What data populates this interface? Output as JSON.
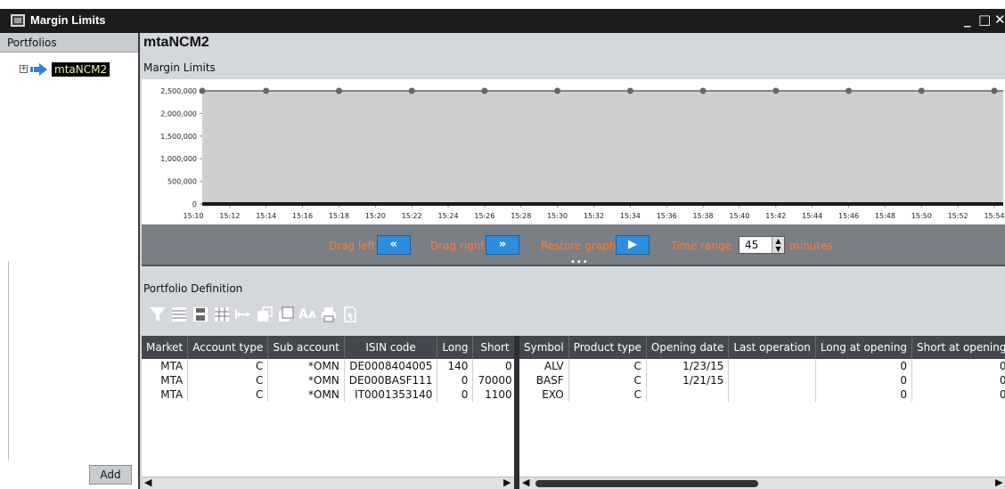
{
  "window": {
    "title": "Margin Limits",
    "controls": [
      "_",
      "□",
      "✕"
    ]
  },
  "left_panel": {
    "header": "Portfolios",
    "tree_item": "mtaNCM2",
    "add_button": "Add"
  },
  "main": {
    "portfolio_title": "mtaNCM2",
    "section_title": "Margin Limits",
    "definition_title": "Portfolio Definition"
  },
  "chart_data": {
    "type": "line",
    "title": "",
    "xlabel": "",
    "ylabel": "",
    "y_ticks": [
      "2,500,000",
      "2,000,000",
      "1,500,000",
      "1,000,000",
      "500,000",
      "0"
    ],
    "x_ticks": [
      "15:10",
      "15:12",
      "15:14",
      "15:16",
      "15:18",
      "15:20",
      "15:22",
      "15:24",
      "15:26",
      "15:28",
      "15:30",
      "15:32",
      "15:34",
      "15:36",
      "15:38",
      "15:40",
      "15:42",
      "15:44",
      "15:46",
      "15:48",
      "15:50",
      "15:52",
      "15:54"
    ],
    "ylim": [
      0,
      2500000
    ],
    "grid": false,
    "series": [
      {
        "x": [
          "15:10",
          "15:14",
          "15:18",
          "15:22",
          "15:26",
          "15:30",
          "15:34",
          "15:38",
          "15:42",
          "15:46",
          "15:50",
          "15:54"
        ],
        "values": [
          2500000,
          2500000,
          2500000,
          2500000,
          2500000,
          2500000,
          2500000,
          2500000,
          2500000,
          2500000,
          2500000,
          2500000
        ],
        "color": "#666666"
      },
      {
        "x": [
          "15:10",
          "15:54"
        ],
        "values": [
          0,
          0
        ],
        "color": "#1a1a1a"
      }
    ]
  },
  "controls": {
    "drag_left": "Drag left",
    "drag_right": "Drag right",
    "restore_graph": "Restore graph",
    "time_range": "Time range",
    "time_value": "45",
    "minutes": "minutes",
    "label_color": "#ff7d2a"
  },
  "toolbar_icons": [
    "filter-icon",
    "list-icon",
    "save-icon",
    "columns-icon",
    "expand-width-icon",
    "copy-icon",
    "copy-all-icon",
    "font-size-icon",
    "print-icon",
    "export-icon"
  ],
  "left_table": {
    "columns": [
      "Market",
      "Account type",
      "Sub account",
      "ISIN code",
      "Long",
      "Short"
    ],
    "rows": [
      [
        "MTA",
        "C",
        "*OMN",
        "DE0008404005",
        "140",
        "0"
      ],
      [
        "MTA",
        "C",
        "*OMN",
        "DE000BASF111",
        "0",
        "70000"
      ],
      [
        "MTA",
        "C",
        "*OMN",
        "IT0001353140",
        "0",
        "1100"
      ]
    ]
  },
  "right_table": {
    "columns": [
      "Symbol",
      "Product type",
      "Opening date",
      "Last operation",
      "Long at opening",
      "Short at opening"
    ],
    "rows": [
      [
        "ALV",
        "C",
        "1/23/15",
        "",
        "0",
        "0"
      ],
      [
        "BASF",
        "C",
        "1/21/15",
        "",
        "0",
        "0"
      ],
      [
        "EXO",
        "C",
        "",
        "",
        "0",
        "0"
      ]
    ]
  }
}
